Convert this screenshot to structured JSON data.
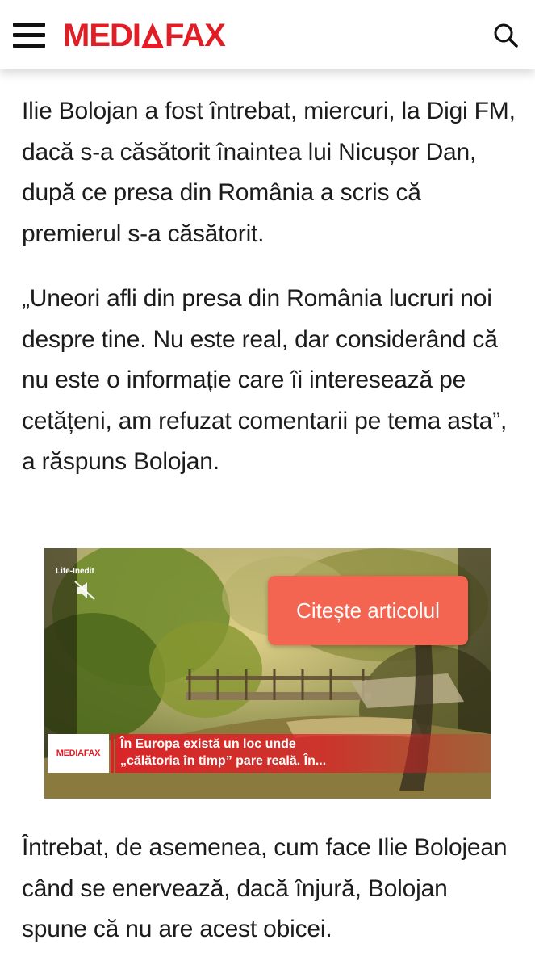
{
  "header": {
    "logo_left": "MEDI",
    "logo_right": "FAX",
    "brand_color": "#e11d26",
    "menu_icon": "hamburger-menu-icon",
    "search_icon": "search-icon"
  },
  "article": {
    "paragraph1": "Ilie Bolojan a fost întrebat, miercuri, la Digi FM, dacă s-a căsătorit înaintea lui Nicușor Dan, după ce presa din România a scris că premierul s-a căsătorit.",
    "paragraph2": "„Uneori afli din presa din România lucruri noi despre tine. Nu este real, dar considerând că nu este o informație care îi interesează pe cetățeni, am refuzat comentarii pe tema asta”, a răspuns Bolojan.",
    "paragraph3": "Întrebat, de asemenea, cum face Ilie Bolojean când se enervează, dacă înjură, Bolojan spune că nu are acest obicei."
  },
  "video": {
    "category_tag": "Life-Inedit",
    "cta_label": "Citește articolul",
    "cta_color": "#f36550",
    "badge_label": "MEDIAFAX",
    "headline_line1": "În Europa există un loc unde",
    "headline_line2": "„călătoria în timp” pare reală. În...",
    "mute_icon": "muted-speaker-icon"
  }
}
